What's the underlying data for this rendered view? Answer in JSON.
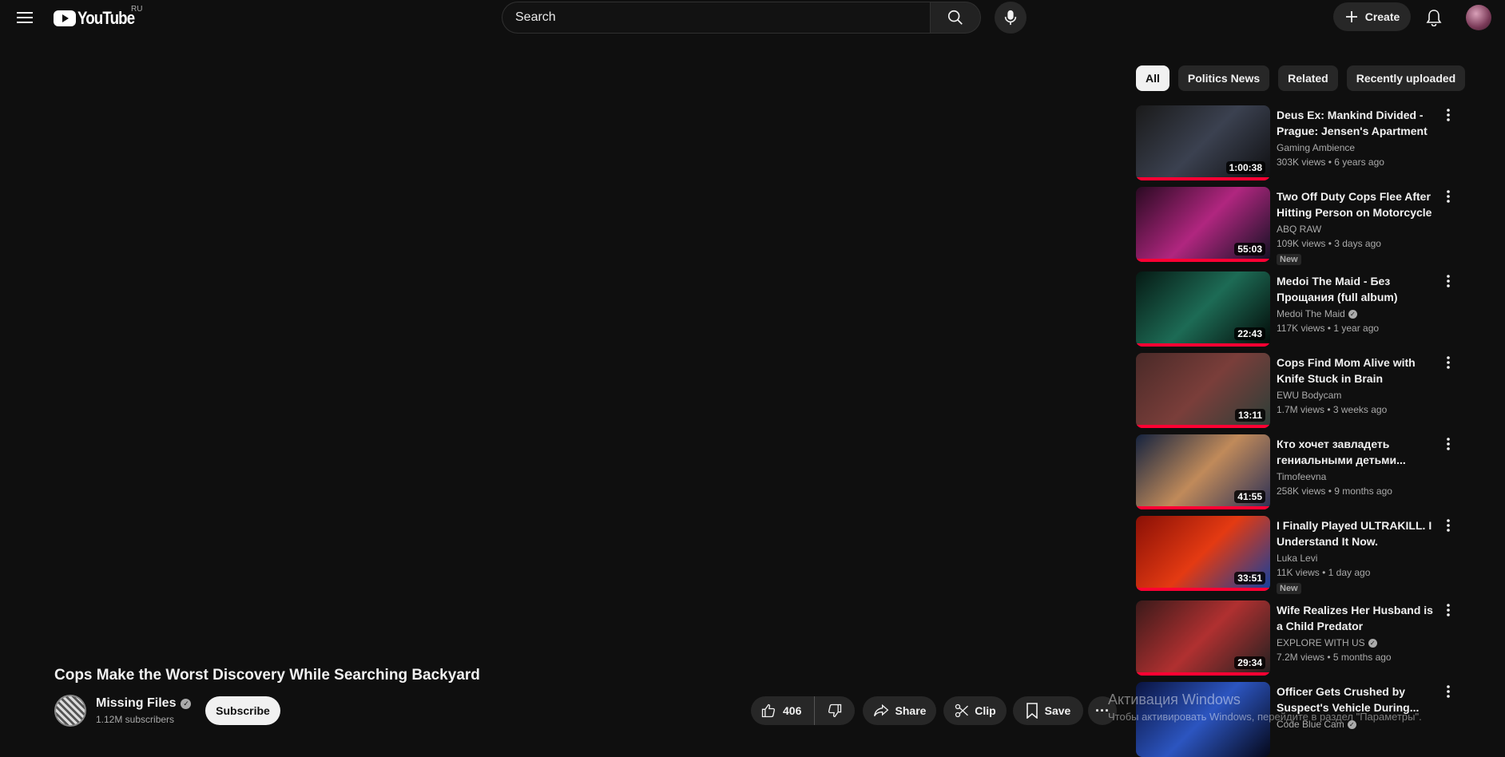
{
  "header": {
    "logo_text": "YouTube",
    "region": "RU",
    "search_placeholder": "Search",
    "create_label": "Create"
  },
  "video": {
    "title": "Cops Make the Worst Discovery While Searching Backyard",
    "channel_name": "Missing Files",
    "subscribers": "1.12M subscribers",
    "subscribe_label": "Subscribe",
    "like_count": "406",
    "share_label": "Share",
    "clip_label": "Clip",
    "save_label": "Save"
  },
  "chips": [
    "All",
    "Politics News",
    "Related",
    "Recently uploaded"
  ],
  "recommendations": [
    {
      "title": "Deus Ex: Mankind Divided - Prague: Jensen's Apartment at...",
      "channel": "Gaming Ambience",
      "verified": false,
      "meta": "303K views  •  6 years ago",
      "duration": "1:00:38",
      "badge": "",
      "thumb_colors": [
        "#1a1a1a",
        "#3b4150",
        "#0e0e10"
      ]
    },
    {
      "title": "Two Off Duty Cops Flee After Hitting Person on Motorcycle",
      "channel": "ABQ RAW",
      "verified": false,
      "meta": "109K views  •  3 days ago",
      "duration": "55:03",
      "badge": "New",
      "thumb_colors": [
        "#2a0a22",
        "#b0267f",
        "#111122"
      ]
    },
    {
      "title": "Medoi The Maid - Без Прощания (full album)",
      "channel": "Medoi The Maid",
      "verified": true,
      "meta": "117K views  •  1 year ago",
      "duration": "22:43",
      "badge": "",
      "thumb_colors": [
        "#061a14",
        "#1d6b55",
        "#020806"
      ]
    },
    {
      "title": "Cops Find Mom Alive with Knife Stuck in Brain",
      "channel": "EWU Bodycam",
      "verified": false,
      "meta": "1.7M views  •  3 weeks ago",
      "duration": "13:11",
      "badge": "",
      "thumb_colors": [
        "#4a2a28",
        "#7a3e3a",
        "#2b3e38"
      ]
    },
    {
      "title": "Кто хочет завладеть гениальными детьми...",
      "channel": "Timofeevna",
      "verified": false,
      "meta": "258K views  •  9 months ago",
      "duration": "41:55",
      "badge": "",
      "thumb_colors": [
        "#15233f",
        "#c08a5a",
        "#2a2f55"
      ]
    },
    {
      "title": "I Finally Played ULTRAKILL. I Understand It Now.",
      "channel": "Luka Levi",
      "verified": false,
      "meta": "11K views  •  1 day ago",
      "duration": "33:51",
      "badge": "New",
      "thumb_colors": [
        "#8a1006",
        "#e43a12",
        "#1040a0"
      ]
    },
    {
      "title": "Wife Realizes Her Husband is a Child Predator",
      "channel": "EXPLORE WITH US",
      "verified": true,
      "meta": "7.2M views  •  5 months ago",
      "duration": "29:34",
      "badge": "",
      "thumb_colors": [
        "#3a1a1a",
        "#b03030",
        "#202020"
      ]
    },
    {
      "title": "Officer Gets Crushed by Suspect's Vehicle During...",
      "channel": "Code Blue Cam",
      "verified": true,
      "meta": "",
      "duration": "",
      "badge": "",
      "thumb_colors": [
        "#0a1440",
        "#2c55c0",
        "#05081a"
      ]
    }
  ],
  "watermark": {
    "line1": "Активация Windows",
    "line2": "Чтобы активировать Windows, перейдите в раздел \"Параметры\"."
  }
}
